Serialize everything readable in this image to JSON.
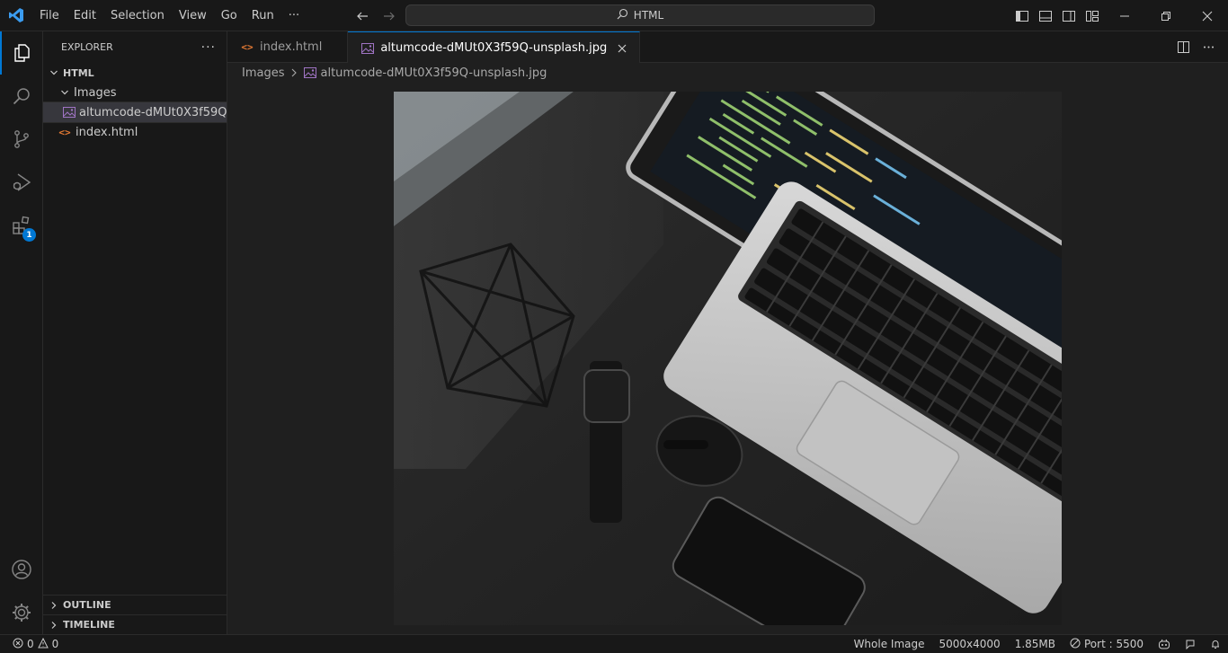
{
  "titlebar": {
    "menu": [
      "File",
      "Edit",
      "Selection",
      "View",
      "Go",
      "Run",
      "···"
    ],
    "command_center": "HTML"
  },
  "activitybar": {
    "items": [
      "explorer-icon",
      "search-icon",
      "source-control-icon",
      "run-debug-icon",
      "extensions-icon"
    ],
    "extensions_badge": "1"
  },
  "sidebar": {
    "title": "EXPLORER",
    "more": "···",
    "root": "HTML",
    "tree": [
      {
        "label": "Images",
        "type": "folder",
        "depth": 1
      },
      {
        "label": "altumcode-dMUt0X3f59Q...",
        "type": "image",
        "depth": 2,
        "selected": true
      },
      {
        "label": "index.html",
        "type": "html",
        "depth": 1
      }
    ],
    "outline": "OUTLINE",
    "timeline": "TIMELINE"
  },
  "tabs": [
    {
      "label": "index.html",
      "type": "html",
      "active": false
    },
    {
      "label": "altumcode-dMUt0X3f59Q-unsplash.jpg",
      "type": "image",
      "active": true
    }
  ],
  "breadcrumb": {
    "folder": "Images",
    "file": "altumcode-dMUt0X3f59Q-unsplash.jpg"
  },
  "statusbar": {
    "errors": "0",
    "warnings": "0",
    "zoom": "Whole Image",
    "dimensions": "5000x4000",
    "size": "1.85MB",
    "port": "Port : 5500"
  },
  "colors": {
    "accent": "#0078d4",
    "html_icon": "#e37933",
    "image_icon": "#a074c4"
  }
}
